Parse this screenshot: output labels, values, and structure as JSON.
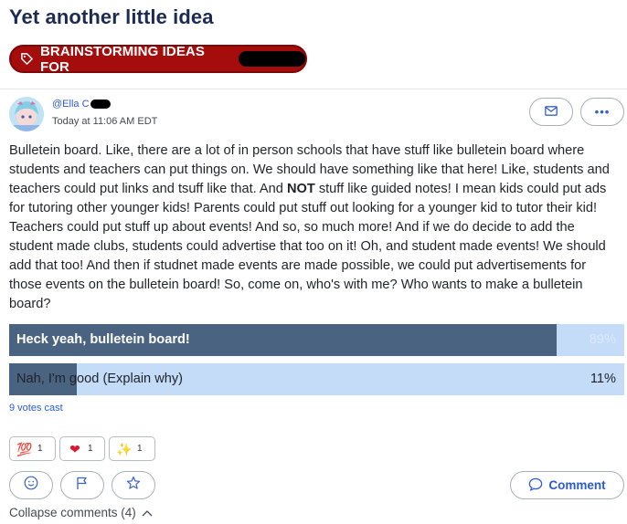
{
  "post": {
    "title": "Yet another little idea",
    "category_tag": "BRAINSTORMING IDEAS FOR",
    "author": "@Ella C",
    "timestamp": "Today at 11:06 AM EDT",
    "body_part1": "Bulletein board. Like, there are a lot of in person schools that have stuff like bulletein board where students and teachers can put things on. We should have something like that here! Like, students and teachers could put links and tsuff like that. And ",
    "body_bold": "NOT",
    "body_part2": " stuff like guided notes! I mean kids could put ads for tutoring other younger kids! Parents could put stuff out looking for a younger kid to tutor their kid! Teachers could put stuff up about events! And so, so much more! And if we do decide to add the student made clubs, students could advertise that too on it! Oh, and student made events! We should add that too! And then if studnet made events are made possible, we could put advertisements for those events on the bulletein board! So, come on, who's with me? Who wants to make a bulletein board?"
  },
  "poll": {
    "options": [
      {
        "label": "Heck yeah, bulletein board!",
        "percent_label": "89%",
        "share": 0.89
      },
      {
        "label": "Nah, I'm good (Explain why)",
        "percent_label": "11%",
        "share": 0.11
      }
    ],
    "votes": "9 votes cast"
  },
  "reactions": [
    {
      "icon": "hundred-points-icon",
      "glyph": "💯",
      "count": "1"
    },
    {
      "icon": "heart-icon",
      "glyph": "❤",
      "count": "1"
    },
    {
      "icon": "sparkles-icon",
      "glyph": "✨",
      "count": "1"
    }
  ],
  "actions": {
    "comment_label": "Comment",
    "collapse_label": "Collapse comments (4)"
  },
  "colors": {
    "tag_background": "#a50c0c",
    "title": "#1b2b52",
    "link_accent": "#2a5bd7",
    "poll_fill": "#4a6380",
    "poll_track": "#c4dcf7"
  }
}
